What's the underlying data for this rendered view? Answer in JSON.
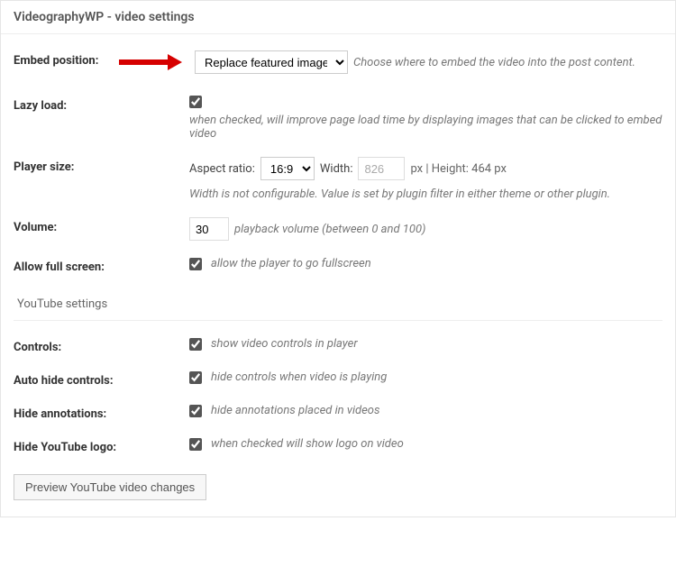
{
  "header": "VideographyWP - video settings",
  "embed": {
    "label": "Embed position:",
    "value": "Replace featured image",
    "options": [
      "Replace featured image"
    ],
    "hint": "Choose where to embed the video into the post content."
  },
  "lazy": {
    "label": "Lazy load:",
    "checked": true,
    "hint": "when checked, will improve page load time by displaying images that can be clicked to embed video"
  },
  "player": {
    "label": "Player size:",
    "aspect_label": "Aspect ratio:",
    "aspect_value": "16:9",
    "aspect_options": [
      "16:9"
    ],
    "width_label": "Width:",
    "width_value": "826",
    "px_height_label": "px | Height: 464 px",
    "note": "Width is not configurable. Value is set by plugin filter in either theme or other plugin."
  },
  "volume": {
    "label": "Volume:",
    "value": "30",
    "hint": "playback volume (between 0 and 100)"
  },
  "fullscreen": {
    "label": "Allow full screen:",
    "checked": true,
    "hint": "allow the player to go fullscreen"
  },
  "yt_subheader": "YouTube settings",
  "controls": {
    "label": "Controls:",
    "checked": true,
    "hint": "show video controls in player"
  },
  "autohide": {
    "label": "Auto hide controls:",
    "checked": true,
    "hint": "hide controls when video is playing"
  },
  "annotations": {
    "label": "Hide annotations:",
    "checked": true,
    "hint": "hide annotations placed in videos"
  },
  "logo": {
    "label": "Hide YouTube logo:",
    "checked": true,
    "hint": "when checked will show logo on video"
  },
  "preview_button": "Preview YouTube video changes"
}
